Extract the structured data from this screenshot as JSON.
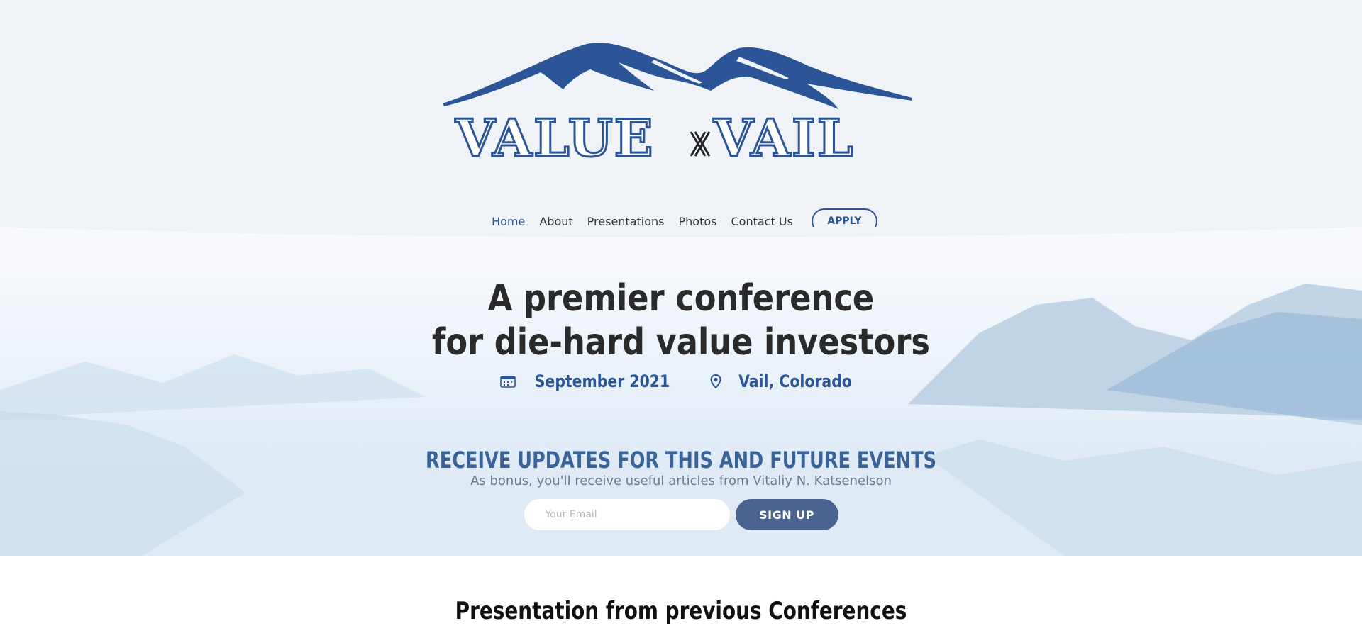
{
  "colors": {
    "brand_blue": "#2c5597",
    "header_bg": "#eff2f7",
    "signup_button": "#4a6390",
    "hero_text": "#2a2a2a"
  },
  "logo": {
    "word_left": "VALUE",
    "word_right": "VAIL",
    "icon": "mountain-logo-icon"
  },
  "nav": {
    "items": [
      {
        "label": "Home",
        "active": true
      },
      {
        "label": "About",
        "active": false
      },
      {
        "label": "Presentations",
        "active": false
      },
      {
        "label": "Photos",
        "active": false
      },
      {
        "label": "Contact Us",
        "active": false
      }
    ],
    "apply_label": "APPLY"
  },
  "hero": {
    "title_line1": "A premier conference",
    "title_line2": "for die-hard value investors",
    "date": "September 2021",
    "date_icon": "calendar-icon",
    "location": "Vail, Colorado",
    "location_icon": "map-pin-icon"
  },
  "updates": {
    "title": "RECEIVE UPDATES FOR THIS AND FUTURE EVENTS",
    "subtitle": "As bonus, you'll receive useful articles from Vitaliy N. Katsenelson",
    "email_placeholder": "Your Email",
    "email_value": "",
    "signup_label": "SIGN UP"
  },
  "previous": {
    "title": "Presentation from previous Conferences"
  }
}
